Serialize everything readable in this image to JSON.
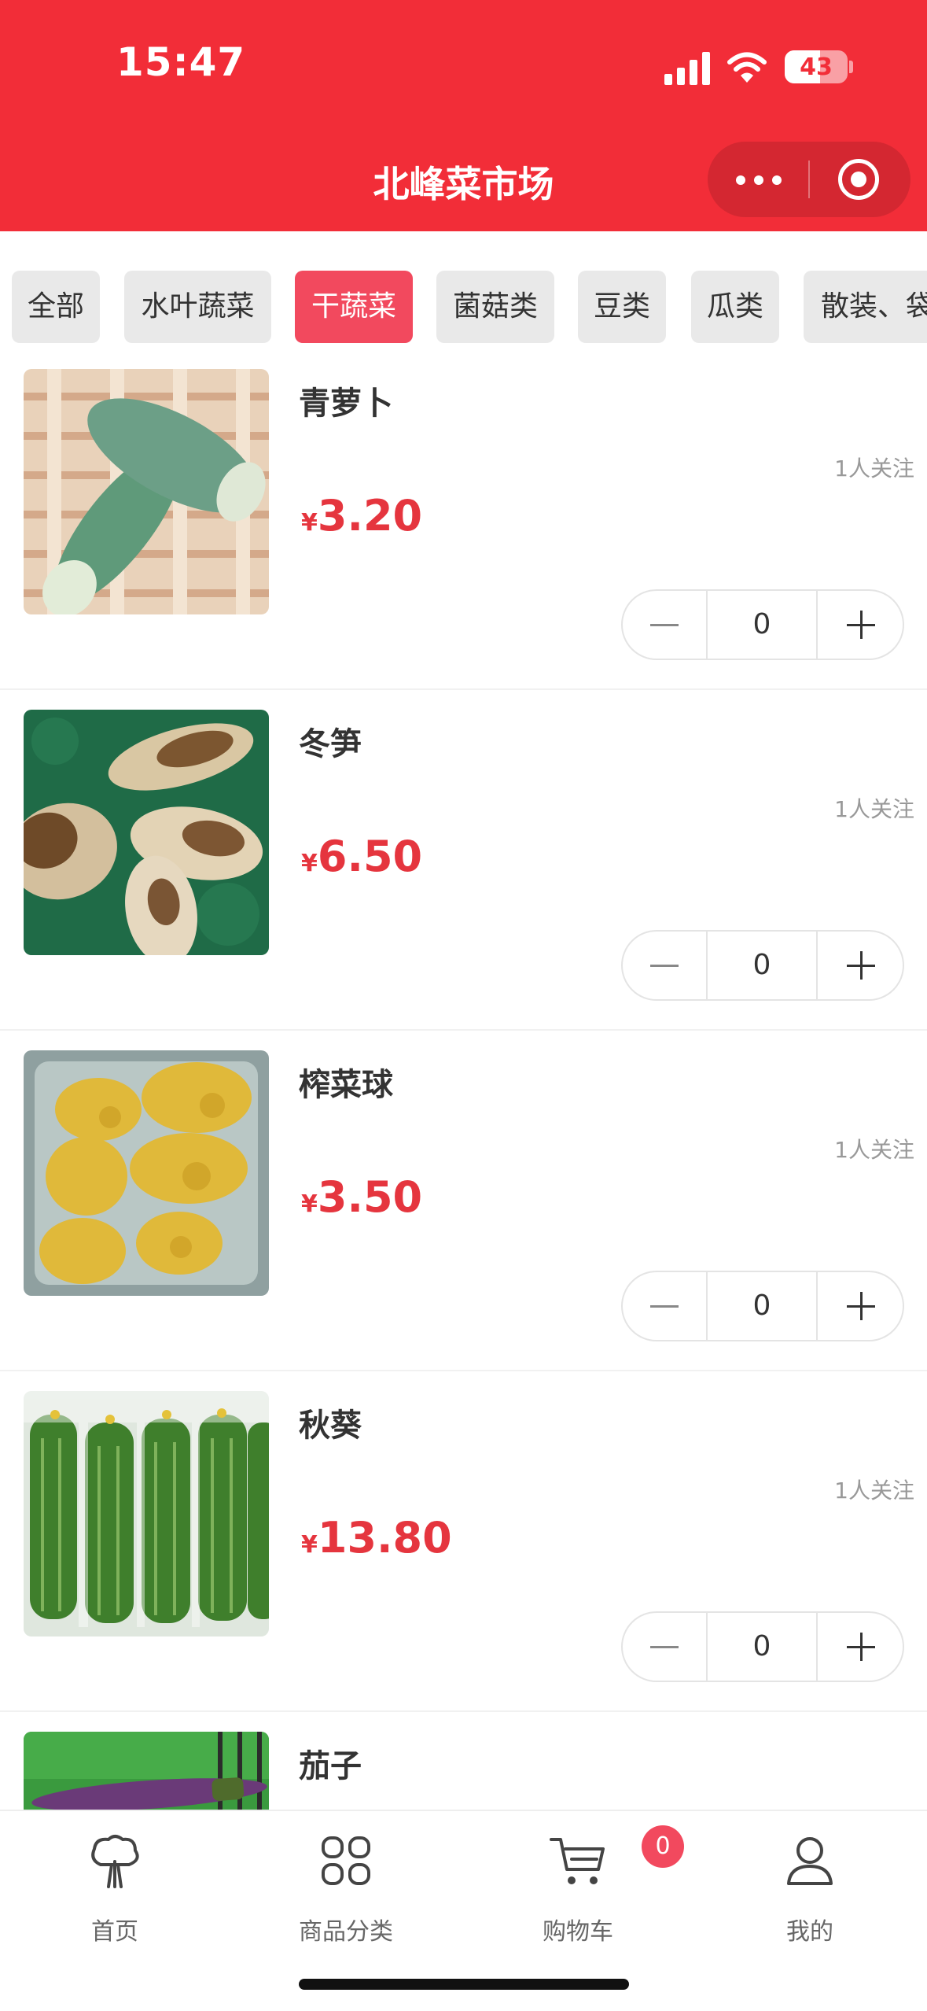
{
  "status_bar": {
    "time": "15:47",
    "battery": "43"
  },
  "header": {
    "title": "北峰菜市场"
  },
  "tabs": [
    {
      "label": "全部"
    },
    {
      "label": "水叶蔬菜"
    },
    {
      "label": "干蔬菜",
      "active": true
    },
    {
      "label": "菌菇类"
    },
    {
      "label": "豆类"
    },
    {
      "label": "瓜类"
    },
    {
      "label": "散装、袋"
    }
  ],
  "products": [
    {
      "name": "青萝卜",
      "followers": "1人关注",
      "currency": "¥",
      "price": "3.20",
      "quantity": "0"
    },
    {
      "name": "冬笋",
      "followers": "1人关注",
      "currency": "¥",
      "price": "6.50",
      "quantity": "0"
    },
    {
      "name": "榨菜球",
      "followers": "1人关注",
      "currency": "¥",
      "price": "3.50",
      "quantity": "0"
    },
    {
      "name": "秋葵",
      "followers": "1人关注",
      "currency": "¥",
      "price": "13.80",
      "quantity": "0"
    },
    {
      "name": "茄子"
    }
  ],
  "tabbar": {
    "items": [
      {
        "label": "首页",
        "icon": "vegetable-icon"
      },
      {
        "label": "商品分类",
        "icon": "grid-icon"
      },
      {
        "label": "购物车",
        "icon": "cart-icon"
      },
      {
        "label": "我的",
        "icon": "user-icon"
      }
    ],
    "cart_count": "0"
  },
  "colors": {
    "brand": "#f22d38",
    "price": "#e5353e",
    "active_tab": "#f2495e"
  }
}
